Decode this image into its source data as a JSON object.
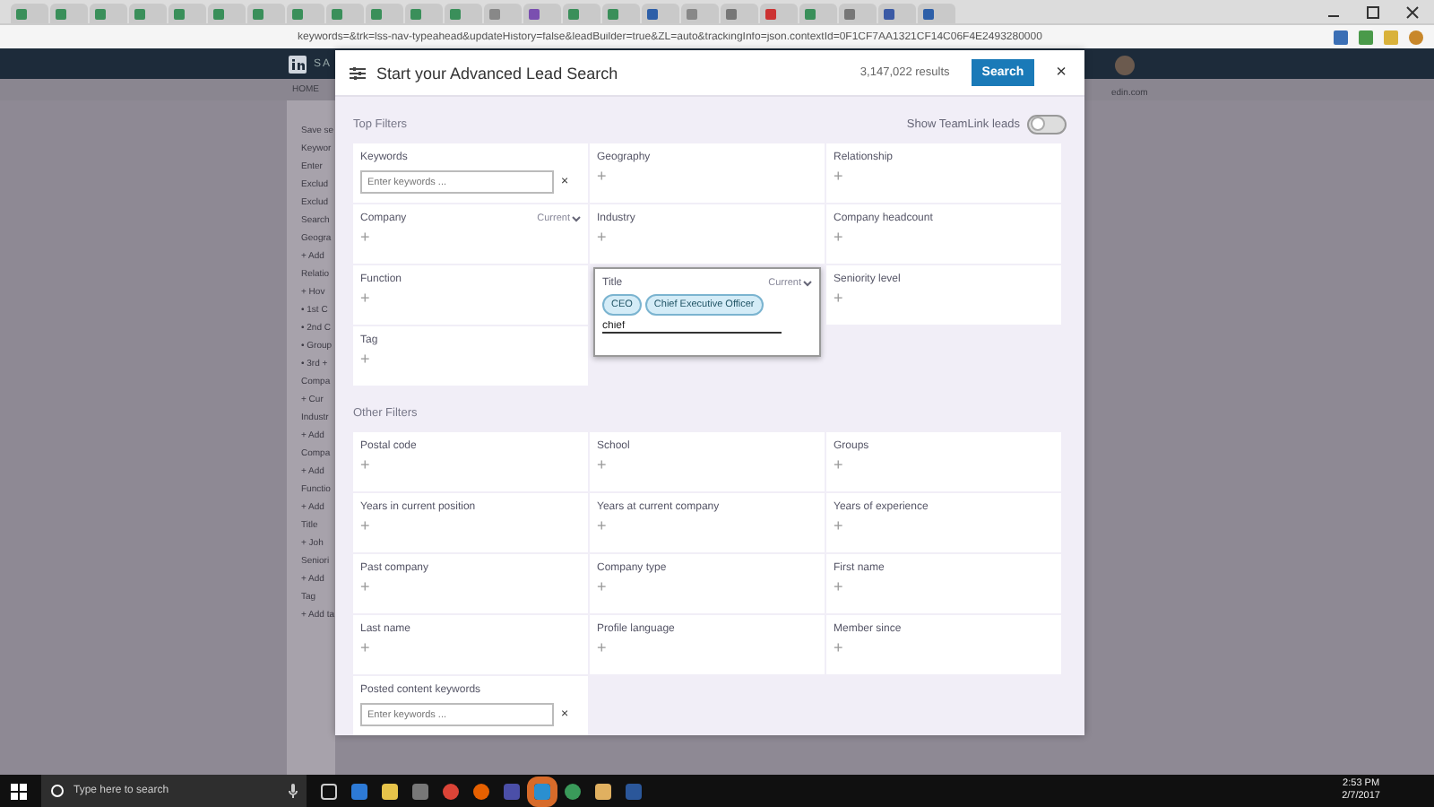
{
  "browser": {
    "tabs": [
      {
        "color": "#3a8f5a"
      },
      {
        "color": "#3a8f5a"
      },
      {
        "color": "#3a8f5a"
      },
      {
        "color": "#3a8f5a"
      },
      {
        "color": "#3a8f5a"
      },
      {
        "color": "#3a8f5a"
      },
      {
        "color": "#3a8f5a"
      },
      {
        "color": "#3a8f5a"
      },
      {
        "color": "#3a8f5a"
      },
      {
        "color": "#3a8f5a"
      },
      {
        "color": "#3a8f5a"
      },
      {
        "color": "#3a8f5a"
      },
      {
        "color": "#888888"
      },
      {
        "color": "#7a4fb0"
      },
      {
        "color": "#3a8f5a"
      },
      {
        "color": "#3a8f5a"
      },
      {
        "color": "#2d5fa8"
      },
      {
        "color": "#888888"
      },
      {
        "color": "#777777"
      },
      {
        "color": "#cc3333"
      },
      {
        "color": "#3a8f5a"
      },
      {
        "color": "#777777"
      },
      {
        "color": "#3b5aa5"
      },
      {
        "color": "#2d5fa8"
      }
    ],
    "address": "keywords=&trk=lss-nav-typeahead&updateHistory=false&leadBuilder=true&ZL=auto&trackingInfo=json.contextId=0F1CF7AA1321CF14C06F4E2493280000"
  },
  "background_page": {
    "brand_text": "SA",
    "nav_item": "HOME",
    "domain_text": "edin.com",
    "sidebar": [
      "Save se",
      "Keywor",
      "Enter",
      "Exclud",
      "Exclud",
      "Search",
      "Geogra",
      "+ Add",
      "Relatio",
      "+ Hov",
      "• 1st C",
      "• 2nd C",
      "• Group",
      "• 3rd +",
      "Compa",
      "+ Cur",
      "Industr",
      "+ Add",
      "Compa",
      "+ Add",
      "Functio",
      "+ Add",
      "Title",
      "+ Joh",
      "Seniori",
      "+ Add",
      "Tag",
      "+ Add ta"
    ]
  },
  "modal": {
    "title": "Start your Advanced Lead Search",
    "results": "3,147,022 results",
    "search_button": "Search",
    "close": "×"
  },
  "top_filters": {
    "heading": "Top Filters",
    "toggle": {
      "label": "Show TeamLink leads",
      "on": false
    },
    "items": [
      {
        "kind": "keywords",
        "label": "Keywords",
        "placeholder": "Enter keywords ...",
        "clear": "×"
      },
      {
        "kind": "add",
        "label": "Geography",
        "add": "+"
      },
      {
        "kind": "add",
        "label": "Relationship",
        "add": "+"
      },
      {
        "kind": "add",
        "label": "Company",
        "qualifier": "Current",
        "add": "+"
      },
      {
        "kind": "add",
        "label": "Industry",
        "add": "+"
      },
      {
        "kind": "add",
        "label": "Company headcount",
        "add": "+"
      },
      {
        "kind": "add",
        "label": "Function",
        "add": "+"
      },
      {
        "kind": "title",
        "label": "Title",
        "qualifier": "Current",
        "tags": [
          "CEO",
          "Chief Executive Officer"
        ],
        "value": "chief"
      },
      {
        "kind": "add",
        "label": "Seniority level",
        "add": "+"
      },
      {
        "kind": "add",
        "label": "Tag",
        "add": "+"
      }
    ]
  },
  "other_filters": {
    "heading": "Other Filters",
    "items": [
      {
        "kind": "add",
        "label": "Postal code",
        "add": "+"
      },
      {
        "kind": "add",
        "label": "School",
        "add": "+"
      },
      {
        "kind": "add",
        "label": "Groups",
        "add": "+"
      },
      {
        "kind": "add",
        "label": "Years in current position",
        "add": "+"
      },
      {
        "kind": "add",
        "label": "Years at current company",
        "add": "+"
      },
      {
        "kind": "add",
        "label": "Years of experience",
        "add": "+"
      },
      {
        "kind": "add",
        "label": "Past company",
        "add": "+"
      },
      {
        "kind": "add",
        "label": "Company type",
        "add": "+"
      },
      {
        "kind": "add",
        "label": "First name",
        "add": "+"
      },
      {
        "kind": "add",
        "label": "Last name",
        "add": "+"
      },
      {
        "kind": "add",
        "label": "Profile language",
        "add": "+"
      },
      {
        "kind": "add",
        "label": "Member since",
        "add": "+"
      },
      {
        "kind": "keywords",
        "label": "Posted content keywords",
        "placeholder": "Enter keywords ...",
        "clear": "×"
      }
    ]
  },
  "taskbar": {
    "search_placeholder": "Type here to search",
    "time": "2:53 PM",
    "date": "2/7/2017"
  }
}
